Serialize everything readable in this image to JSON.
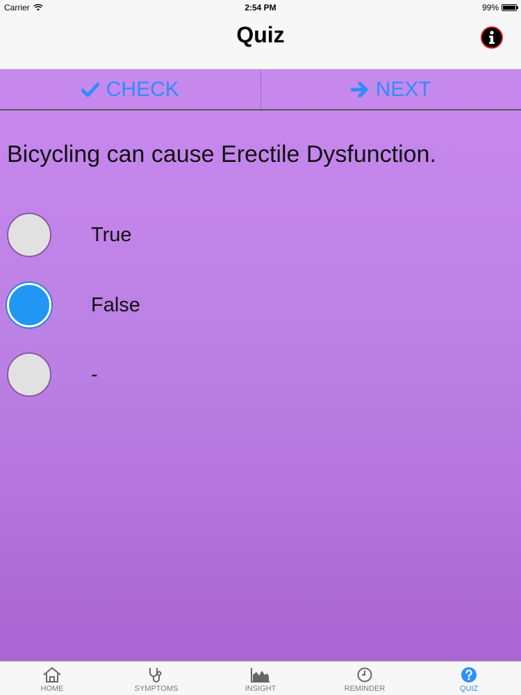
{
  "status_bar": {
    "carrier": "Carrier",
    "time": "2:54 PM",
    "battery": "99%",
    "battery_level": 0.99
  },
  "nav": {
    "title": "Quiz",
    "info_icon": "info-icon"
  },
  "actions": {
    "check_label": "CHECK",
    "check_icon": "checkmark-icon",
    "next_label": "NEXT",
    "next_icon": "arrow-right-icon"
  },
  "question": {
    "text": "Bicycling can cause Erectile Dysfunction."
  },
  "options": [
    {
      "label": "True",
      "selected": false
    },
    {
      "label": "False",
      "selected": true
    },
    {
      "label": "-",
      "selected": false
    }
  ],
  "tabs": [
    {
      "label": "HOME",
      "icon": "home-icon",
      "active": false
    },
    {
      "label": "SYMPTOMS",
      "icon": "stethoscope-icon",
      "active": false
    },
    {
      "label": "INSIGHT",
      "icon": "area-chart-icon",
      "active": false
    },
    {
      "label": "REMINDER",
      "icon": "clock-icon",
      "active": false
    },
    {
      "label": "QUIZ",
      "icon": "question-icon",
      "active": true
    }
  ],
  "colors": {
    "accent": "#2b8ff7",
    "selected_radio": "#2196f3",
    "background_top": "#c889ef",
    "background_bottom": "#a965d2"
  }
}
